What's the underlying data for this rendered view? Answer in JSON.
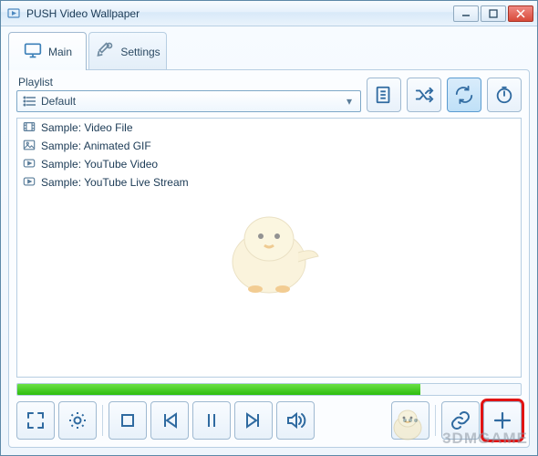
{
  "window": {
    "title": "PUSH Video Wallpaper"
  },
  "tabs": {
    "main": "Main",
    "settings": "Settings"
  },
  "playlist": {
    "label": "Playlist",
    "selected": "Default"
  },
  "list": {
    "items": [
      {
        "icon": "film",
        "label": "Sample: Video File"
      },
      {
        "icon": "image",
        "label": "Sample: Animated GIF"
      },
      {
        "icon": "youtube",
        "label": "Sample: YouTube Video"
      },
      {
        "icon": "youtube",
        "label": "Sample: YouTube Live Stream"
      }
    ]
  },
  "watermark": "3DMGAME"
}
